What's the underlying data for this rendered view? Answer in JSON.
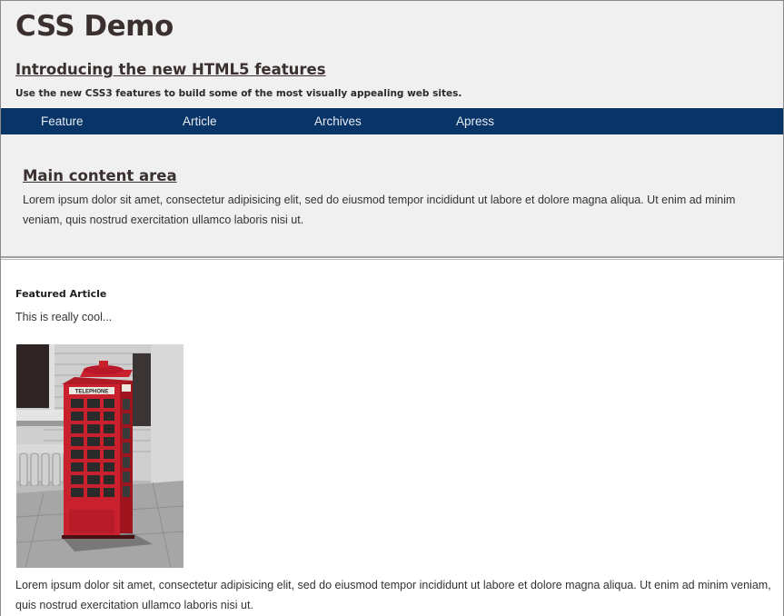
{
  "header": {
    "title": "CSS Demo",
    "subtitle": "Introducing the new HTML5 features",
    "tagline": "Use the new CSS3 features to build some of the most visually appealing web sites."
  },
  "nav": {
    "items": [
      {
        "label": "Feature"
      },
      {
        "label": "Article"
      },
      {
        "label": "Archives"
      },
      {
        "label": "Apress"
      }
    ]
  },
  "main": {
    "heading": "Main content area",
    "text": "Lorem ipsum dolor sit amet, consectetur adipisicing elit, sed do eiusmod tempor incididunt ut labore et dolore magna aliqua. Ut enim ad minim veniam, quis nostrud exercitation ullamco laboris nisi ut."
  },
  "article": {
    "heading": "Featured Article",
    "intro": "This is really cool...",
    "image_sign": "TELEPHONE",
    "body": "Lorem ipsum dolor sit amet, consectetur adipisicing elit, sed do eiusmod tempor incididunt ut labore et dolore magna aliqua. Ut enim ad minim veniam, quis nostrud exercitation ullamco laboris nisi ut."
  },
  "colors": {
    "nav_background": "#083468",
    "panel_background": "#f0f0f0",
    "telephone_box": "#c8202c"
  }
}
